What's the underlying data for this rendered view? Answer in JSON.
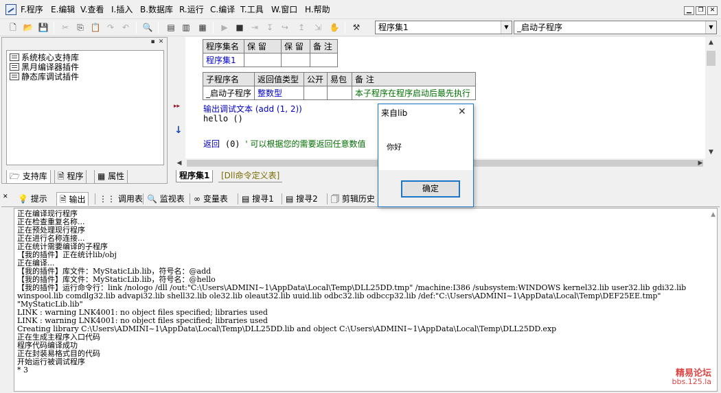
{
  "menu": {
    "items": [
      "F.程序",
      "E.编辑",
      "V.查看",
      "I.插入",
      "B.数据库",
      "R.运行",
      "C.编译",
      "T.工具",
      "W.窗口",
      "H.帮助"
    ]
  },
  "toolbar": {
    "combo_left": "程序集1",
    "combo_right": "_启动子程序"
  },
  "left_panel": {
    "libraries": [
      "系统核心支持库",
      "黑月编译器插件",
      "静态库调试插件"
    ],
    "tabs": [
      "支持库",
      "程序",
      "属性"
    ]
  },
  "module_table": {
    "headers": [
      "程序集名",
      "保 留",
      "保 留",
      "备 注"
    ],
    "row": [
      "程序集1",
      "",
      "",
      ""
    ]
  },
  "sub_table": {
    "headers": [
      "子程序名",
      "返回值类型",
      "公开",
      "易包",
      "备 注"
    ],
    "row": [
      "_启动子程序",
      "整数型",
      "",
      "",
      "本子程序在程序启动后最先执行"
    ]
  },
  "code": {
    "line1": "输出调试文本 (add (1, 2))",
    "line2": "hello ()",
    "line3_kw": "返回",
    "line3_arg": "(0)",
    "line3_comment": "' 可以根据您的需要返回任意数值"
  },
  "editor_tabs": [
    "程序集1",
    "[Dll命令定义表]"
  ],
  "bottom_tabs": [
    "提示",
    "输出",
    "调用表",
    "监视表",
    "变量表",
    "搜寻1",
    "搜寻2",
    "剪辑历史"
  ],
  "output_lines": [
    "正在编译现行程序",
    "正在检查重复名称...",
    "正在预处理现行程序",
    "正在进行名称连接...",
    "正在统计需要编译的子程序",
    "【我的插件】正在统计lib/obj",
    "正在编译...",
    "【我的插件】库文件：MyStaticLib.lib，符号名：@add",
    "【我的插件】库文件：MyStaticLib.lib，符号名：@hello",
    "【我的插件】运行命令行：link /nologo /dll /out:\"C:\\Users\\ADMINI~1\\AppData\\Local\\Temp\\DLL25DD.tmp\" /machine:I386 /subsystem:WINDOWS kernel32.lib user32.lib gdi32.lib",
    "winspool.lib comdlg32.lib advapi32.lib shell32.lib ole32.lib oleaut32.lib uuid.lib odbc32.lib odbccp32.lib /def:\"C:\\Users\\ADMINI~1\\AppData\\Local\\Temp\\DEF25EE.tmp\"",
    "\"MyStaticLib.lib\"",
    "LINK : warning LNK4001: no object files specified; libraries used",
    "LINK : warning LNK4001: no object files specified; libraries used",
    "   Creating library C:\\Users\\ADMINI~1\\AppData\\Local\\Temp\\DLL25DD.lib and object C:\\Users\\ADMINI~1\\AppData\\Local\\Temp\\DLL25DD.exp",
    "正在生成主程序入口代码",
    "程序代码编译成功",
    "正在封装易格式目的代码",
    "开始运行被调试程序",
    "* 3"
  ],
  "dialog": {
    "title": "来自lib",
    "message": "你好",
    "ok_label": "确定"
  },
  "watermark": {
    "line1": "精易论坛",
    "line2": "bbs.125.la"
  },
  "colors": {
    "keyword_blue": "#0000c8",
    "comment_green": "#007000",
    "dialog_border": "#1a75c8"
  }
}
